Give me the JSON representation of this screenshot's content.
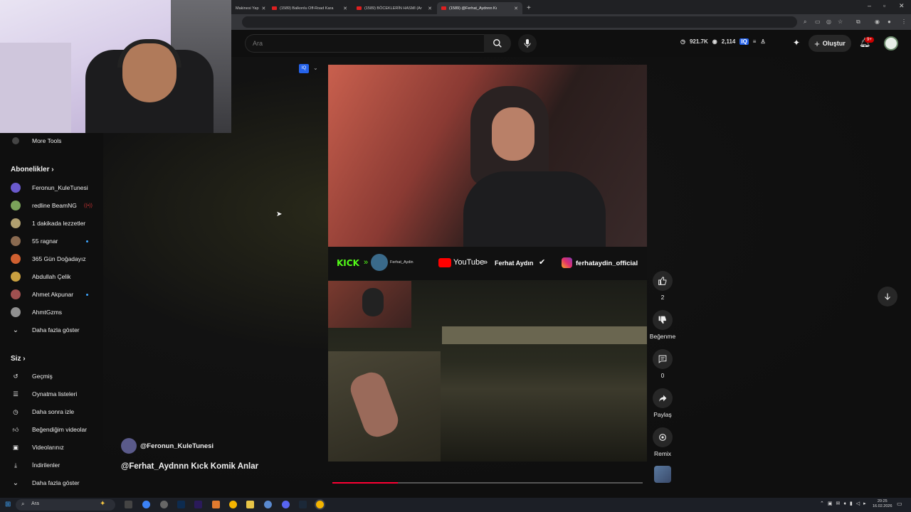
{
  "browser": {
    "tabs": [
      {
        "title": "Makinesi Yap",
        "active": false
      },
      {
        "title": "(1589) Balkonlu Off-Road Kara",
        "active": false
      },
      {
        "title": "(1589) BÖCEKLERİN HASMI (Ar",
        "active": false
      },
      {
        "title": "(1589) @Ferhat_Aydnnn Kı",
        "active": true
      }
    ],
    "new_tab": "+"
  },
  "header": {
    "search_placeholder": "Ara",
    "views": "921.7K",
    "watchers": "2,114",
    "create_label": "Oluştur",
    "notif_badge": "9+"
  },
  "sidebar": {
    "more_tools": "More Tools",
    "subs_heading": "Abonelikler",
    "subscriptions": [
      {
        "name": "Feronun_KuleTunesi",
        "color": "#6a5acd"
      },
      {
        "name": "redline BeamNG",
        "color": "#7aa35a"
      },
      {
        "name": "1 dakikada lezzetler",
        "color": "#b0a070"
      },
      {
        "name": "55 ragnar",
        "color": "#8a6a50"
      },
      {
        "name": "365 Gün Doğadayız",
        "color": "#d06030"
      },
      {
        "name": "Abdullah Çelik",
        "color": "#c9a040"
      },
      {
        "name": "Ahmet Akpunar",
        "color": "#a05050"
      },
      {
        "name": "AhmtGzms",
        "color": "#909090"
      }
    ],
    "show_more_subs": "Daha fazla göster",
    "you_heading": "Siz",
    "you_items": [
      {
        "label": "Geçmiş",
        "icon": "history-icon"
      },
      {
        "label": "Oynatma listeleri",
        "icon": "playlist-icon"
      },
      {
        "label": "Daha sonra izle",
        "icon": "clock-icon"
      },
      {
        "label": "Beğendiğim videolar",
        "icon": "thumbs-up-icon"
      },
      {
        "label": "Videolarınız",
        "icon": "video-icon"
      },
      {
        "label": "İndirilenler",
        "icon": "download-icon"
      }
    ],
    "show_more_you": "Daha fazla göster"
  },
  "short": {
    "channel": "@Feronun_KuleTunesi",
    "title": "@Ferhat_Aydnnn Kıck Komik Anlar",
    "overlay": {
      "kick": "KICK",
      "kick_user": "Ferhat_Aydin",
      "youtube": "YouTube",
      "youtube_user": "Ferhat Aydın",
      "instagram": "ferhataydin_official"
    },
    "progress": 0.21,
    "likes": "2",
    "dislike_label": "Beğenme",
    "comments": "0",
    "share_label": "Paylaş",
    "remix_label": "Remix"
  },
  "taskbar": {
    "search": "Ara",
    "time": "20:25",
    "date": "16.02.2026"
  }
}
